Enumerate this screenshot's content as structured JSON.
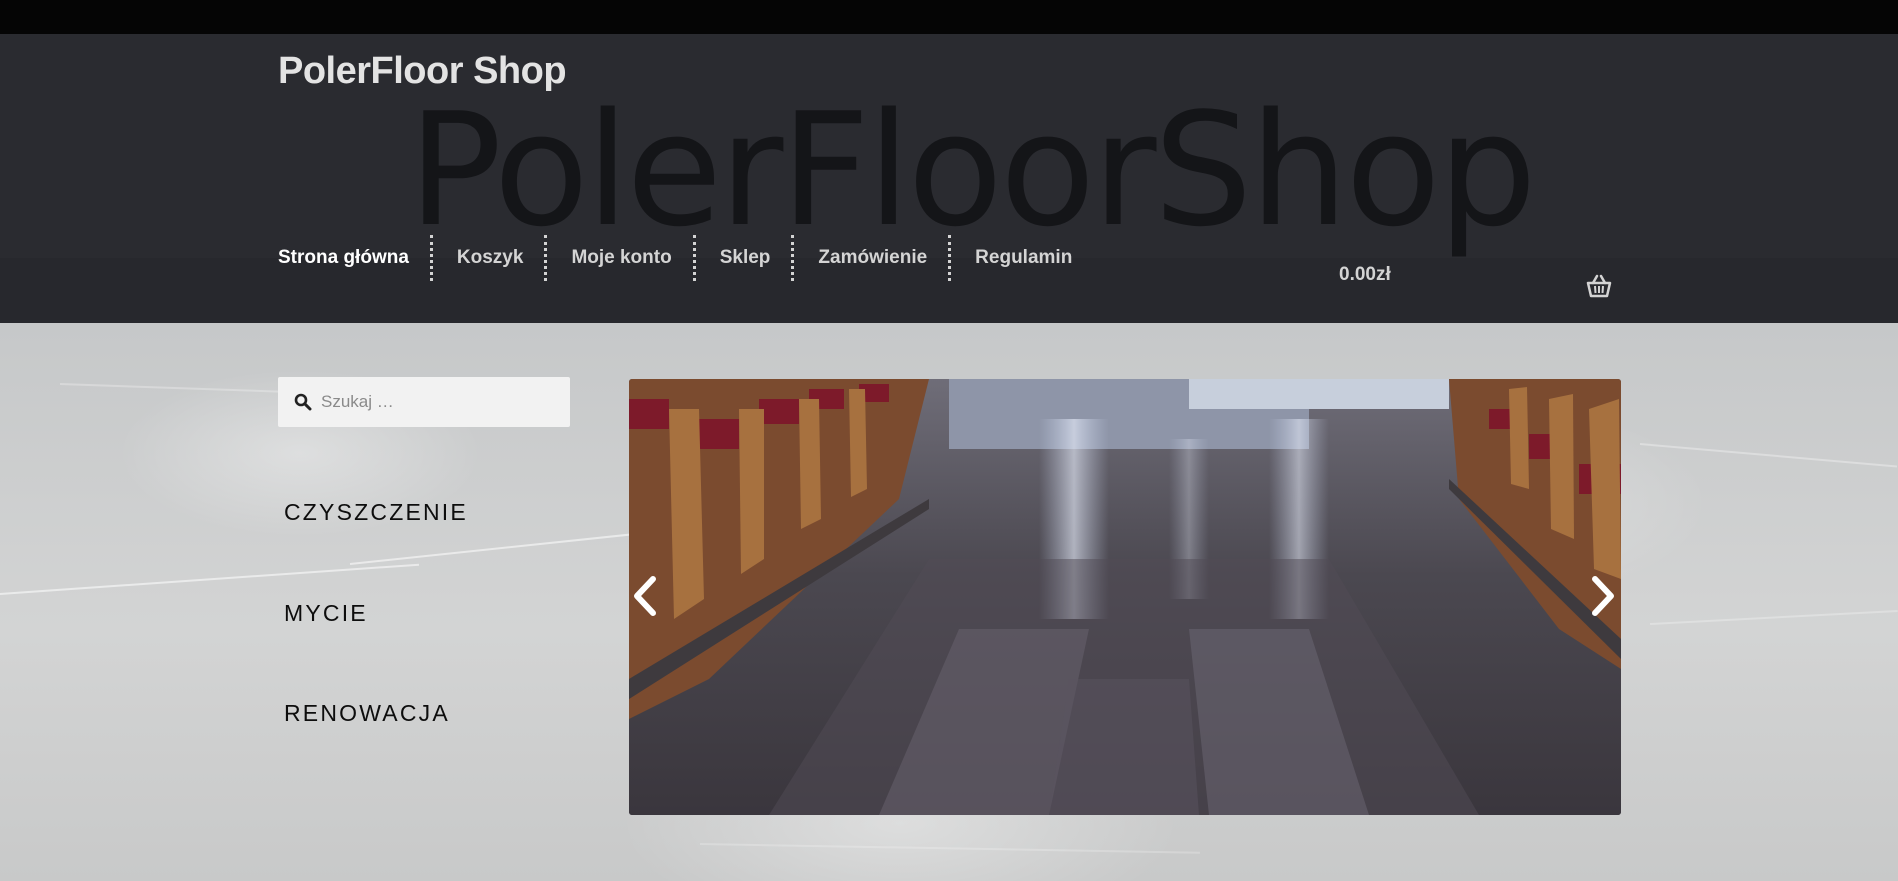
{
  "header": {
    "site_title": "PolerFloor Shop",
    "logo_text": "PolerFloorShop"
  },
  "nav": {
    "items": [
      "Strona główna",
      "Koszyk",
      "Moje konto",
      "Sklep",
      "Zamówienie",
      "Regulamin"
    ],
    "cart_total": "0.00zł",
    "cart_icon": "basket-icon"
  },
  "search": {
    "placeholder": "Szukaj …",
    "value": ""
  },
  "categories": [
    "CZYSZCZENIE",
    "MYCIE",
    "RENOWACJA"
  ],
  "slider": {
    "prev_icon": "chevron-left-icon",
    "next_icon": "chevron-right-icon"
  },
  "colors": {
    "topbar": "#050505",
    "header_bg": "#2a2b30",
    "nav_text": "#d4d4d4",
    "category_text": "#0d0d0d"
  }
}
